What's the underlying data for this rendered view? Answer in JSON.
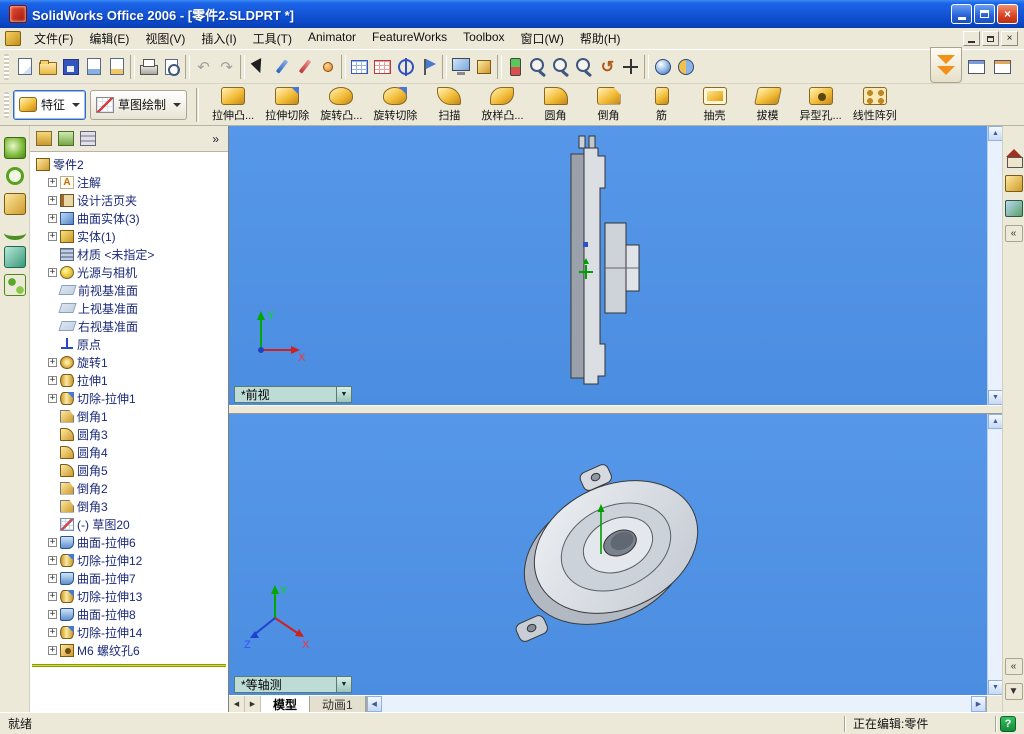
{
  "titlebar": {
    "title": "SolidWorks Office 2006 - [零件2.SLDPRT *]"
  },
  "glyphs": {
    "close": "×",
    "down": "▼",
    "up": "▲",
    "left": "◀",
    "right": "▶",
    "chev_left": "«",
    "chev_right": "»"
  },
  "menubar": {
    "items": [
      "文件(F)",
      "编辑(E)",
      "视图(V)",
      "插入(I)",
      "工具(T)",
      "Animator",
      "FeatureWorks",
      "Toolbox",
      "窗口(W)",
      "帮助(H)"
    ]
  },
  "standard_toolbar": {
    "icons": [
      {
        "name": "new-document-icon",
        "style": "page",
        "inter": "true"
      },
      {
        "name": "open-icon",
        "style": "folder",
        "inter": "true"
      },
      {
        "name": "save-icon",
        "style": "floppy",
        "inter": "true"
      },
      {
        "name": "make-drawing-icon",
        "style": "page-blue",
        "inter": "true"
      },
      {
        "name": "make-assembly-icon",
        "style": "page-gold",
        "inter": "true"
      },
      {
        "name": "separator",
        "style": "sep",
        "inter": "false"
      },
      {
        "name": "print-icon",
        "style": "printer",
        "inter": "true"
      },
      {
        "name": "print-preview-icon",
        "style": "magpage",
        "inter": "true"
      },
      {
        "name": "separator",
        "style": "sep",
        "inter": "false"
      },
      {
        "name": "undo-icon",
        "style": "undo",
        "inter": "true"
      },
      {
        "name": "redo-icon",
        "style": "redo",
        "inter": "true"
      },
      {
        "name": "separator",
        "style": "sep",
        "inter": "false"
      },
      {
        "name": "select-icon",
        "style": "arrow",
        "inter": "true"
      },
      {
        "name": "sketch-icon",
        "style": "pencil",
        "inter": "true"
      },
      {
        "name": "dimension-icon",
        "style": "pencil-red",
        "inter": "true"
      },
      {
        "name": "point-icon",
        "style": "dot",
        "inter": "true"
      },
      {
        "name": "separator",
        "style": "sep",
        "inter": "false"
      },
      {
        "name": "design-table-icon",
        "style": "grid-blue",
        "inter": "true"
      },
      {
        "name": "equations-icon",
        "style": "grid-red",
        "inter": "true"
      },
      {
        "name": "selection-filter-icon",
        "style": "target",
        "inter": "true"
      },
      {
        "name": "filter-flag-icon",
        "style": "flag",
        "inter": "true"
      },
      {
        "name": "separator",
        "style": "sep",
        "inter": "false"
      },
      {
        "name": "view-orientation-icon",
        "style": "monitor",
        "inter": "true"
      },
      {
        "name": "display-style-icon",
        "style": "cube",
        "inter": "true"
      },
      {
        "name": "separator",
        "style": "sep",
        "inter": "false"
      },
      {
        "name": "rebuild-icon",
        "style": "rebuild",
        "inter": "true"
      },
      {
        "name": "zoom-fit-icon",
        "style": "mag",
        "inter": "true"
      },
      {
        "name": "zoom-area-icon",
        "style": "mag",
        "inter": "true"
      },
      {
        "name": "zoom-in-out-icon",
        "style": "mag",
        "inter": "true"
      },
      {
        "name": "rotate-view-icon",
        "style": "rotate",
        "inter": "true"
      },
      {
        "name": "pan-icon",
        "style": "pan",
        "inter": "true"
      },
      {
        "name": "separator",
        "style": "sep",
        "inter": "false"
      },
      {
        "name": "shaded-view-icon",
        "style": "sphere",
        "inter": "true"
      },
      {
        "name": "section-view-icon",
        "style": "section",
        "inter": "true"
      }
    ]
  },
  "feature_bar": {
    "features_tab": "特征",
    "sketch_tab": "草图绘制",
    "buttons": [
      {
        "label": "拉伸凸...",
        "icon": "extrude-boss"
      },
      {
        "label": "拉伸切除",
        "icon": "extrude-cut"
      },
      {
        "label": "旋转凸...",
        "icon": "revolve-boss"
      },
      {
        "label": "旋转切除",
        "icon": "revolve-cut"
      },
      {
        "label": "扫描",
        "icon": "sweep"
      },
      {
        "label": "放样凸...",
        "icon": "loft"
      },
      {
        "label": "圆角",
        "icon": "fillet"
      },
      {
        "label": "倒角",
        "icon": "chamfer"
      },
      {
        "label": "筋",
        "icon": "rib"
      },
      {
        "label": "抽壳",
        "icon": "shell"
      },
      {
        "label": "拔模",
        "icon": "draft"
      },
      {
        "label": "异型孔...",
        "icon": "hole-wizard"
      },
      {
        "label": "线性阵列",
        "icon": "linear-pattern"
      }
    ]
  },
  "left_toolbar": {
    "icons": [
      {
        "name": "spline-tool-icon",
        "style": "g1"
      },
      {
        "name": "ellipse-tool-icon",
        "style": "g2"
      },
      {
        "name": "surface-tool-icon",
        "style": "g3"
      },
      {
        "name": "curve-tool-icon",
        "style": "g4"
      },
      {
        "name": "fillet-surface-tool-icon",
        "style": "g5"
      },
      {
        "name": "helix-tool-icon",
        "style": "g6"
      }
    ]
  },
  "feature_tree": {
    "root": "零件2",
    "items": [
      {
        "expander": "+",
        "icon": "annotation",
        "label": "注解"
      },
      {
        "expander": "+",
        "icon": "binder",
        "label": "设计活页夹"
      },
      {
        "expander": "+",
        "icon": "surface-folder",
        "label": "曲面实体(3)"
      },
      {
        "expander": "+",
        "icon": "solid-folder",
        "label": "实体(1)"
      },
      {
        "expander": "",
        "icon": "material",
        "label": "材质 <未指定>"
      },
      {
        "expander": "+",
        "icon": "lights",
        "label": "光源与相机"
      },
      {
        "expander": "",
        "icon": "plane",
        "label": "前视基准面"
      },
      {
        "expander": "",
        "icon": "plane",
        "label": "上视基准面"
      },
      {
        "expander": "",
        "icon": "plane",
        "label": "右视基准面"
      },
      {
        "expander": "",
        "icon": "origin",
        "label": "原点"
      },
      {
        "expander": "+",
        "icon": "revolve",
        "label": "旋转1"
      },
      {
        "expander": "+",
        "icon": "extrude",
        "label": "拉伸1"
      },
      {
        "expander": "+",
        "icon": "cut-extrude",
        "label": "切除-拉伸1"
      },
      {
        "expander": "",
        "icon": "chamfer",
        "label": "倒角1"
      },
      {
        "expander": "",
        "icon": "fillet",
        "label": "圆角3"
      },
      {
        "expander": "",
        "icon": "fillet",
        "label": "圆角4"
      },
      {
        "expander": "",
        "icon": "fillet",
        "label": "圆角5"
      },
      {
        "expander": "",
        "icon": "chamfer",
        "label": "倒角2"
      },
      {
        "expander": "",
        "icon": "chamfer",
        "label": "倒角3"
      },
      {
        "expander": "",
        "icon": "sketch",
        "label": "(-) 草图20"
      },
      {
        "expander": "+",
        "icon": "surface-extrude",
        "label": "曲面-拉伸6"
      },
      {
        "expander": "+",
        "icon": "cut-extrude",
        "label": "切除-拉伸12"
      },
      {
        "expander": "+",
        "icon": "surface-extrude",
        "label": "曲面-拉伸7"
      },
      {
        "expander": "+",
        "icon": "cut-extrude",
        "label": "切除-拉伸13"
      },
      {
        "expander": "+",
        "icon": "surface-extrude",
        "label": "曲面-拉伸8"
      },
      {
        "expander": "+",
        "icon": "cut-extrude",
        "label": "切除-拉伸14"
      },
      {
        "expander": "+",
        "icon": "hole",
        "label": "M6 螺纹孔6"
      }
    ]
  },
  "viewports": [
    {
      "label": "*前视",
      "axis_x": "X",
      "axis_y": "Y"
    },
    {
      "label": "*等轴测",
      "axis_x": "X",
      "axis_y": "Y",
      "axis_z": "Z"
    }
  ],
  "model_tabs": [
    "模型",
    "动画1"
  ],
  "statusbar": {
    "ready": "就绪",
    "editing": "正在编辑:零件",
    "help": "?"
  }
}
